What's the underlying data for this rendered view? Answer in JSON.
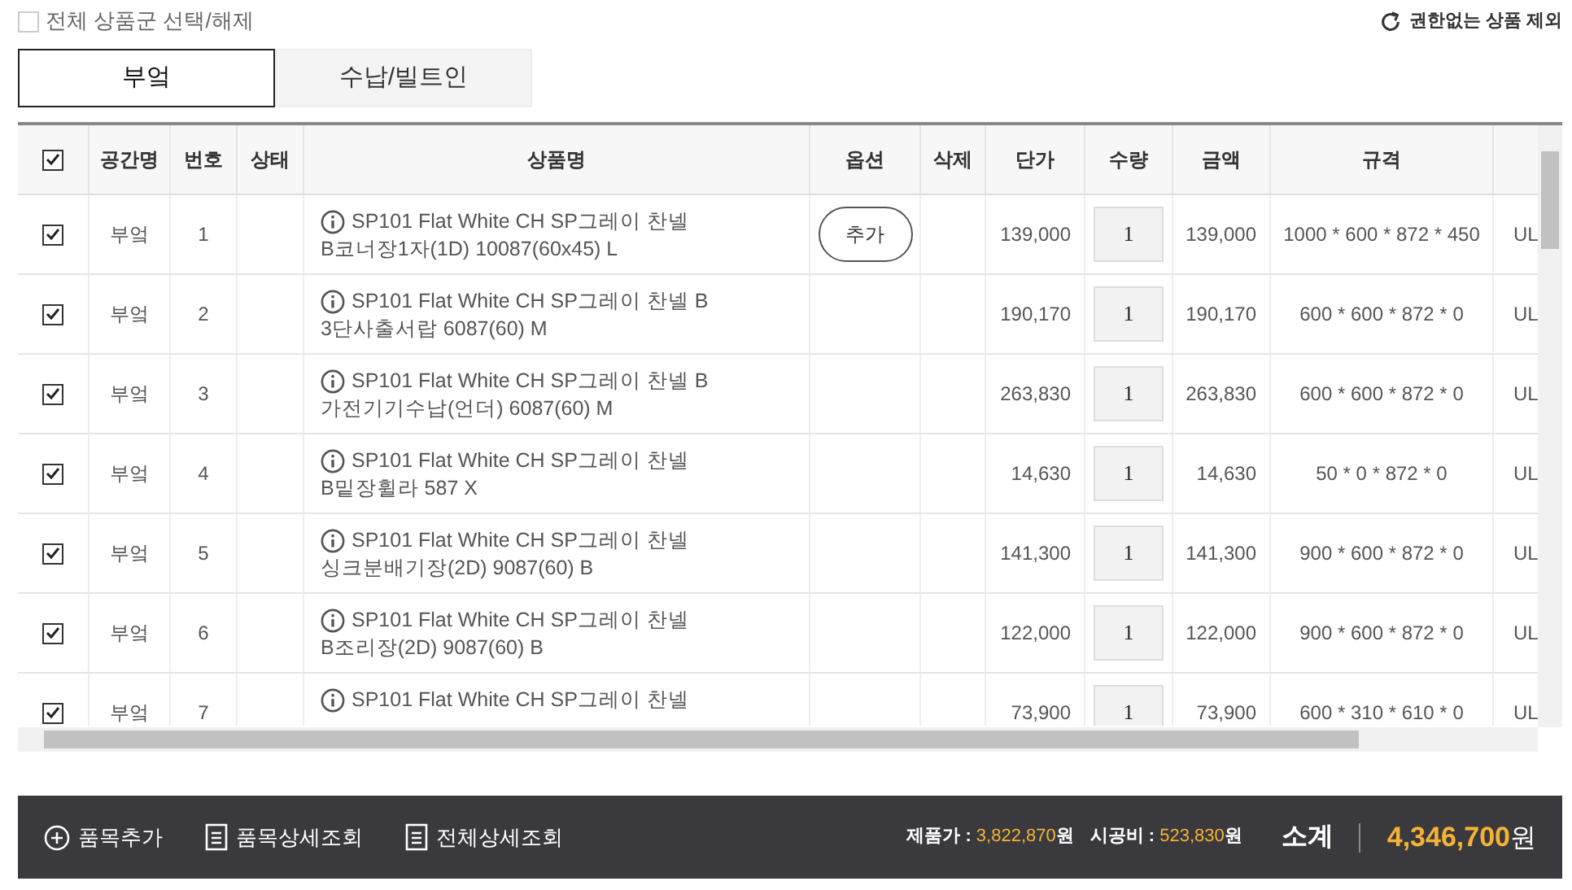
{
  "select_all": {
    "label": "전체 상품군 선택/해제",
    "checked": false
  },
  "exclude_link": "권한없는 상품 제외",
  "tabs": [
    {
      "label": "부엌",
      "selected": true
    },
    {
      "label": "수납/빌트인",
      "selected": false
    }
  ],
  "table": {
    "header_checked": true,
    "columns": [
      "공간명",
      "번호",
      "상태",
      "상품명",
      "옵션",
      "삭제",
      "단가",
      "수량",
      "금액",
      "규격"
    ],
    "rows": [
      {
        "checked": true,
        "space": "부엌",
        "no": "1",
        "name": [
          "SP101 Flat White CH SP그레이 찬넬",
          "B코너장1자(1D) 10087(60x45) L"
        ],
        "option": "추가",
        "price": "139,000",
        "qty": "1",
        "amount": "139,000",
        "spec": "1000 * 600 * 872 * 450",
        "column_12": "UL"
      },
      {
        "checked": true,
        "space": "부엌",
        "no": "2",
        "name": [
          "SP101 Flat White CH SP그레이 찬넬 B",
          "3단사출서랍 6087(60) M"
        ],
        "price": "190,170",
        "qty": "1",
        "amount": "190,170",
        "spec": "600 * 600 * 872 * 0",
        "column_12": "UL"
      },
      {
        "checked": true,
        "space": "부엌",
        "no": "3",
        "name": [
          "SP101 Flat White CH SP그레이 찬넬 B",
          "가전기기수납(언더) 6087(60) M"
        ],
        "price": "263,830",
        "qty": "1",
        "amount": "263,830",
        "spec": "600 * 600 * 872 * 0",
        "column_12": "UL"
      },
      {
        "checked": true,
        "space": "부엌",
        "no": "4",
        "name": [
          "SP101 Flat White CH SP그레이 찬넬",
          "B밑장휠라 587 X"
        ],
        "price": "14,630",
        "qty": "1",
        "amount": "14,630",
        "spec": "50 * 0 * 872 * 0",
        "column_12": "UL"
      },
      {
        "checked": true,
        "space": "부엌",
        "no": "5",
        "name": [
          "SP101 Flat White CH SP그레이 찬넬",
          "싱크분배기장(2D) 9087(60) B"
        ],
        "price": "141,300",
        "qty": "1",
        "amount": "141,300",
        "spec": "900 * 600 * 872 * 0",
        "column_12": "UL"
      },
      {
        "checked": true,
        "space": "부엌",
        "no": "6",
        "name": [
          "SP101 Flat White CH SP그레이 찬넬",
          "B조리장(2D) 9087(60) B"
        ],
        "price": "122,000",
        "qty": "1",
        "amount": "122,000",
        "spec": "900 * 600 * 872 * 0",
        "column_12": "UL"
      },
      {
        "checked": true,
        "space": "부엌",
        "no": "7",
        "name": [
          "SP101 Flat White CH SP그레이 찬넬"
        ],
        "price": "73,900",
        "qty": "1",
        "amount": "73,900",
        "spec": "600 * 310 * 610 * 0",
        "column_12": "UL"
      }
    ]
  },
  "footer": {
    "actions": [
      {
        "kind": "plus",
        "label": "품목추가"
      },
      {
        "kind": "doc",
        "label": "품목상세조회"
      },
      {
        "kind": "doc",
        "label": "전체상세조회"
      }
    ],
    "product_price": {
      "label": "제품가 :",
      "value": "3,822,870",
      "unit": "원"
    },
    "install_fee": {
      "label": "시공비 :",
      "value": "523,830",
      "unit": "원"
    },
    "subtotal": {
      "label": "소계",
      "value": "4,346,700",
      "unit": "원"
    }
  }
}
